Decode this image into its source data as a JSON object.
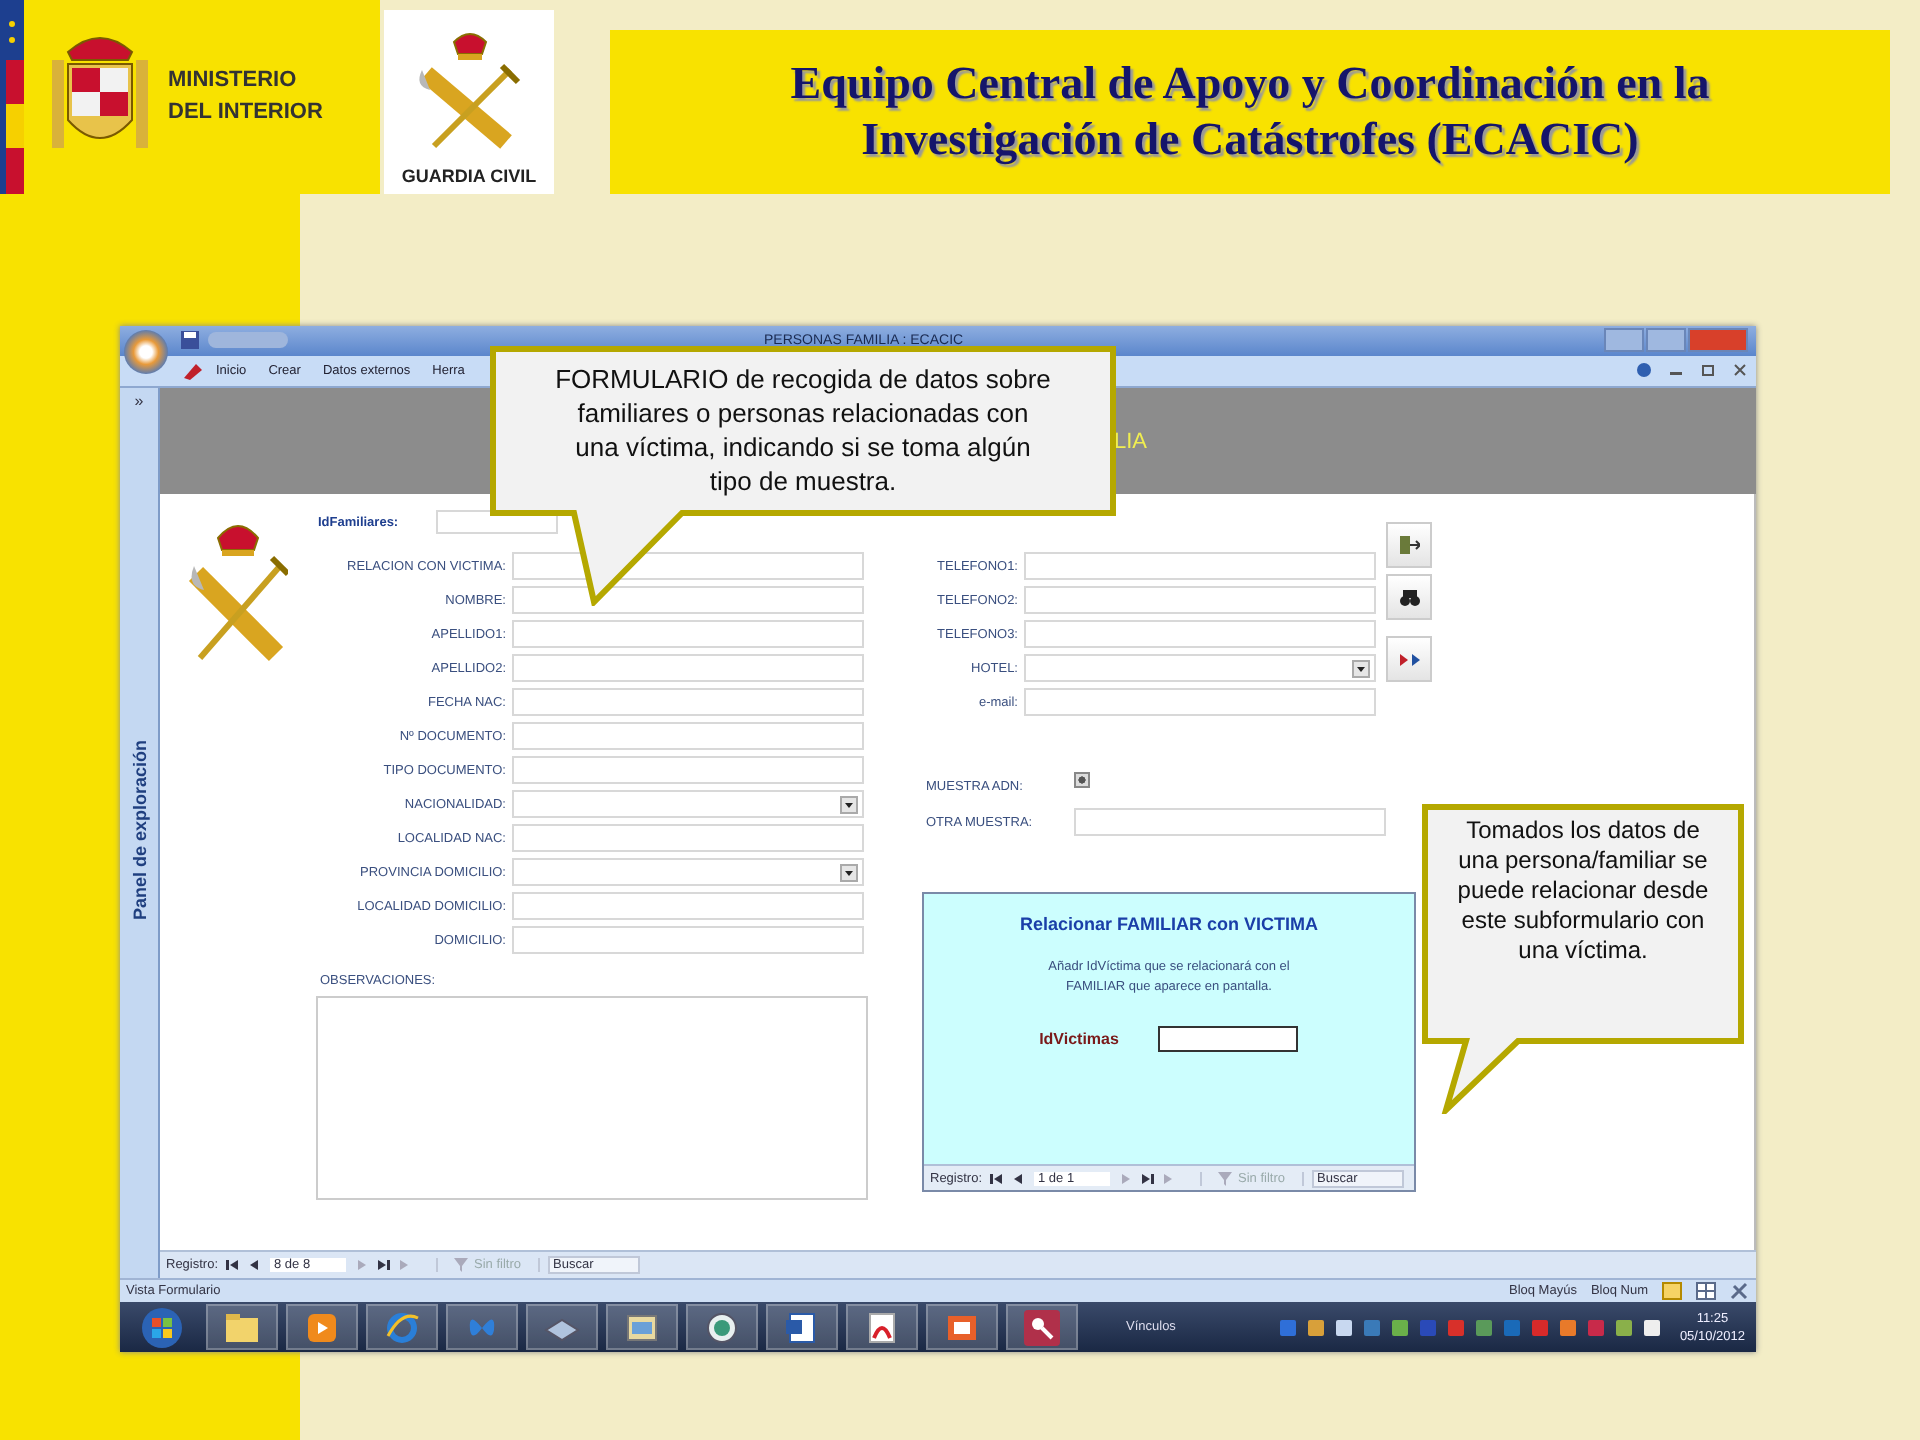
{
  "header": {
    "ministry_lines": [
      "MINISTERIO",
      "DEL INTERIOR"
    ],
    "guardia_civil_label": "GUARDIA CIVIL",
    "title_lines": [
      "Equipo Central de Apoyo y Coordinación en la",
      "Investigación de Catástrofes (ECACIC)"
    ]
  },
  "window": {
    "title": "PERSONAS FAMILIA : ECACIC",
    "ribbon_tabs": [
      "Inicio",
      "Crear",
      "Datos externos",
      "Herra"
    ]
  },
  "nav_pane": {
    "expand_glyph": "»",
    "label": "Panel de exploración"
  },
  "form": {
    "header_title": "LIA",
    "id_label": "IdFamiliares:",
    "left_fields": [
      {
        "label": "RELACION CON VICTIMA:",
        "kind": "text"
      },
      {
        "label": "NOMBRE:",
        "kind": "text"
      },
      {
        "label": "APELLIDO1:",
        "kind": "text"
      },
      {
        "label": "APELLIDO2:",
        "kind": "text"
      },
      {
        "label": "FECHA NAC:",
        "kind": "text"
      },
      {
        "label": "Nº DOCUMENTO:",
        "kind": "text"
      },
      {
        "label": "TIPO DOCUMENTO:",
        "kind": "text"
      },
      {
        "label": "NACIONALIDAD:",
        "kind": "combo"
      },
      {
        "label": "LOCALIDAD NAC:",
        "kind": "text"
      },
      {
        "label": "PROVINCIA DOMICILIO:",
        "kind": "combo"
      },
      {
        "label": "LOCALIDAD DOMICILIO:",
        "kind": "text"
      },
      {
        "label": "DOMICILIO:",
        "kind": "text"
      }
    ],
    "observations_label": "OBSERVACIONES:",
    "right_fields": [
      {
        "label": "TELEFONO1:",
        "kind": "text"
      },
      {
        "label": "TELEFONO2:",
        "kind": "text"
      },
      {
        "label": "TELEFONO3:",
        "kind": "text"
      },
      {
        "label": "HOTEL:",
        "kind": "combo"
      },
      {
        "label": "e-mail:",
        "kind": "text"
      }
    ],
    "dna_sample": {
      "label": "MUESTRA ADN:",
      "checked": true
    },
    "other_sample": {
      "label": "OTRA MUESTRA:"
    },
    "subform": {
      "title": "Relacionar FAMILIAR con VICTIMA",
      "instructions": "Añadr IdVíctima que se relacionará con el FAMILIAR que aparece en pantalla.",
      "id_label": "IdVictimas",
      "record_nav": {
        "label": "Registro:",
        "position": "1 de 1",
        "filter": "Sin filtro",
        "search": "Buscar"
      }
    }
  },
  "record_nav": {
    "label": "Registro:",
    "position": "8 de 8",
    "filter": "Sin filtro",
    "search": "Buscar"
  },
  "status_bar": {
    "view": "Vista Formulario",
    "indicators": [
      "Bloq Mayús",
      "Bloq Num"
    ]
  },
  "taskbar": {
    "toolbar_label": "Vínculos",
    "time": "11:25",
    "date": "05/10/2012"
  },
  "callouts": [
    {
      "text": "FORMULARIO de recogida de datos sobre familiares o personas relacionadas con una víctima, indicando si se toma algún tipo de muestra."
    },
    {
      "text": "Tomados los datos de una persona/familiar se puede relacionar desde este subformulario con una víctima."
    }
  ]
}
